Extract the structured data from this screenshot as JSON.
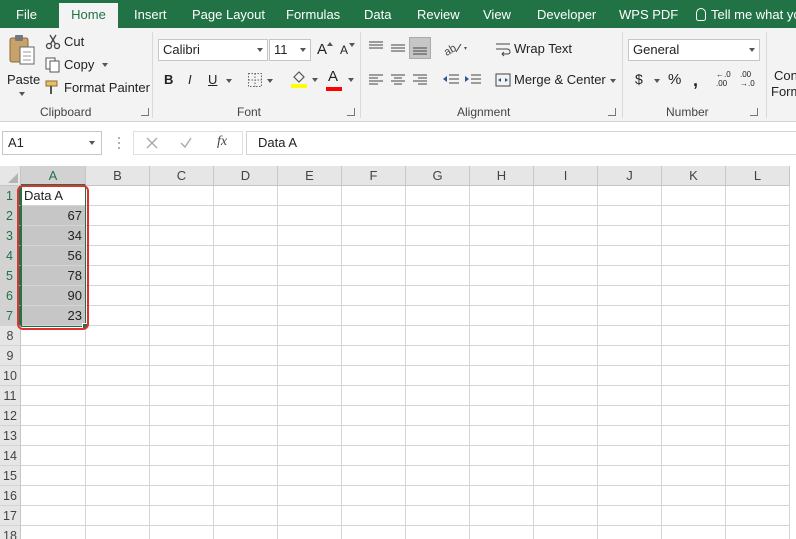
{
  "ribbon_tabs": [
    "File",
    "Home",
    "Insert",
    "Page Layout",
    "Formulas",
    "Data",
    "Review",
    "View",
    "Developer",
    "WPS PDF"
  ],
  "active_tab": "Home",
  "tell_me": "Tell me what yo",
  "clipboard": {
    "paste": "Paste",
    "cut": "Cut",
    "copy": "Copy",
    "format_painter": "Format Painter",
    "label": "Clipboard"
  },
  "font": {
    "name": "Calibri",
    "size": "11",
    "grow": "A",
    "shrink": "A",
    "bold": "B",
    "italic": "I",
    "underline": "U",
    "font_color_letter": "A",
    "label": "Font",
    "highlight_color": "#ffff00",
    "text_color": "#ff0000"
  },
  "alignment": {
    "wrap_text": "Wrap Text",
    "merge_center": "Merge & Center",
    "label": "Alignment"
  },
  "number": {
    "format": "General",
    "currency": "$",
    "percent": "%",
    "comma": ",",
    "inc_decimal": "←.0 .00",
    "dec_decimal": ".00 →.0",
    "label": "Number"
  },
  "styles": {
    "cond_line1": "Con",
    "cond_line2": "Form"
  },
  "formula_bar": {
    "name_box": "A1",
    "fx": "fx",
    "content": "Data A"
  },
  "columns": [
    "A",
    "B",
    "C",
    "D",
    "E",
    "F",
    "G",
    "H",
    "I",
    "J",
    "K",
    "L"
  ],
  "rows": [
    "1",
    "2",
    "3",
    "4",
    "5",
    "6",
    "7",
    "8",
    "9",
    "10",
    "11",
    "12",
    "13",
    "14",
    "15",
    "16",
    "17",
    "18"
  ],
  "cells": {
    "A1": "Data A",
    "A2": "67",
    "A3": "34",
    "A4": "56",
    "A5": "78",
    "A6": "90",
    "A7": "23"
  },
  "colors": {
    "excel_green": "#217346",
    "callout_red": "#e03030",
    "selection_fill": "#c6c6c6"
  }
}
